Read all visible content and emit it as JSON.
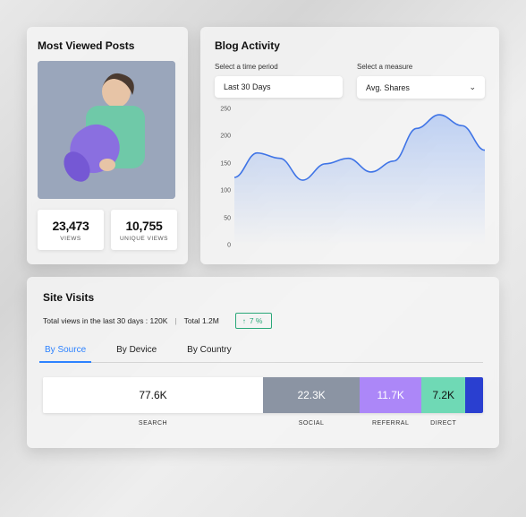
{
  "most_viewed": {
    "title": "Most Viewed Posts",
    "image_desc": "man-holding-yoga-mat",
    "views": {
      "value": "23,473",
      "label": "VIEWS"
    },
    "unique": {
      "value": "10,755",
      "label": "UNIQUE VIEWS"
    }
  },
  "blog_activity": {
    "title": "Blog Activity",
    "period_label": "Select a time period",
    "period_value": "Last 30 Days",
    "measure_label": "Select a measure",
    "measure_value": "Avg. Shares"
  },
  "chart_data": {
    "type": "line",
    "title": "Blog Activity",
    "xlabel": "",
    "ylabel": "",
    "ylim": [
      0,
      250
    ],
    "y_ticks": [
      0,
      50,
      100,
      150,
      200,
      250
    ],
    "x": [
      0,
      1,
      2,
      3,
      4,
      5,
      6,
      7,
      8,
      9,
      10,
      11
    ],
    "values": [
      125,
      170,
      160,
      120,
      150,
      160,
      135,
      155,
      215,
      240,
      220,
      175
    ]
  },
  "site_visits": {
    "title": "Site Visits",
    "totals_prefix": "Total views in the last 30 days : ",
    "last_30": "120K",
    "total_label": "Total ",
    "total_value": "1.2M",
    "change": "7 %"
  },
  "tabs": {
    "by_source": "By Source",
    "by_device": "By Device",
    "by_country": "By Country"
  },
  "segments": [
    {
      "value": "77.6K",
      "label": "SEARCH",
      "color": "#ffffff",
      "textdark": true,
      "pct": 50
    },
    {
      "value": "22.3K",
      "label": "SOCIAL",
      "color": "#8b94a3",
      "textdark": false,
      "pct": 22
    },
    {
      "value": "11.7K",
      "label": "REFERRAL",
      "color": "#ac87f8",
      "textdark": false,
      "pct": 14
    },
    {
      "value": "7.2K",
      "label": "DIRECT",
      "color": "#6fd9b5",
      "textdark": true,
      "pct": 10
    },
    {
      "value": "",
      "label": "",
      "color": "#2a3fd0",
      "textdark": false,
      "pct": 4
    }
  ]
}
